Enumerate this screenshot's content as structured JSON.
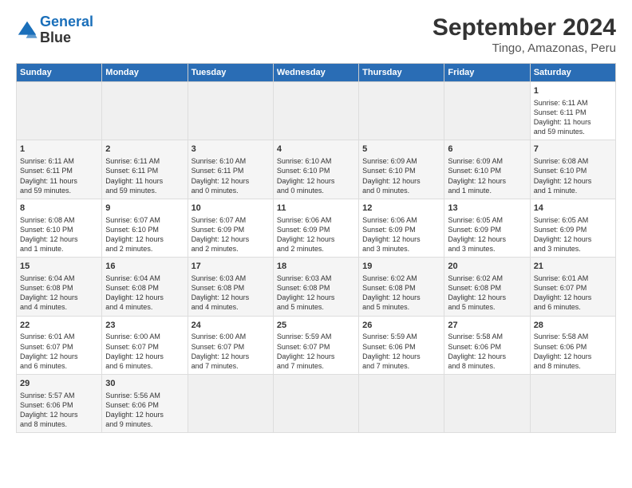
{
  "header": {
    "logo_line1": "General",
    "logo_line2": "Blue",
    "title": "September 2024",
    "subtitle": "Tingo, Amazonas, Peru"
  },
  "calendar": {
    "days_of_week": [
      "Sunday",
      "Monday",
      "Tuesday",
      "Wednesday",
      "Thursday",
      "Friday",
      "Saturday"
    ],
    "weeks": [
      [
        {
          "day": "",
          "content": ""
        },
        {
          "day": "",
          "content": ""
        },
        {
          "day": "",
          "content": ""
        },
        {
          "day": "",
          "content": ""
        },
        {
          "day": "",
          "content": ""
        },
        {
          "day": "",
          "content": ""
        },
        {
          "day": "1",
          "content": "Sunrise: 6:11 AM\nSunset: 6:11 PM\nDaylight: 11 hours\nand 59 minutes."
        }
      ],
      [
        {
          "day": "1",
          "content": "Sunrise: 6:11 AM\nSunset: 6:11 PM\nDaylight: 11 hours\nand 59 minutes."
        },
        {
          "day": "2",
          "content": "Sunrise: 6:11 AM\nSunset: 6:11 PM\nDaylight: 11 hours\nand 59 minutes."
        },
        {
          "day": "3",
          "content": "Sunrise: 6:10 AM\nSunset: 6:11 PM\nDaylight: 12 hours\nand 0 minutes."
        },
        {
          "day": "4",
          "content": "Sunrise: 6:10 AM\nSunset: 6:10 PM\nDaylight: 12 hours\nand 0 minutes."
        },
        {
          "day": "5",
          "content": "Sunrise: 6:09 AM\nSunset: 6:10 PM\nDaylight: 12 hours\nand 0 minutes."
        },
        {
          "day": "6",
          "content": "Sunrise: 6:09 AM\nSunset: 6:10 PM\nDaylight: 12 hours\nand 1 minute."
        },
        {
          "day": "7",
          "content": "Sunrise: 6:08 AM\nSunset: 6:10 PM\nDaylight: 12 hours\nand 1 minute."
        }
      ],
      [
        {
          "day": "8",
          "content": "Sunrise: 6:08 AM\nSunset: 6:10 PM\nDaylight: 12 hours\nand 1 minute."
        },
        {
          "day": "9",
          "content": "Sunrise: 6:07 AM\nSunset: 6:10 PM\nDaylight: 12 hours\nand 2 minutes."
        },
        {
          "day": "10",
          "content": "Sunrise: 6:07 AM\nSunset: 6:09 PM\nDaylight: 12 hours\nand 2 minutes."
        },
        {
          "day": "11",
          "content": "Sunrise: 6:06 AM\nSunset: 6:09 PM\nDaylight: 12 hours\nand 2 minutes."
        },
        {
          "day": "12",
          "content": "Sunrise: 6:06 AM\nSunset: 6:09 PM\nDaylight: 12 hours\nand 3 minutes."
        },
        {
          "day": "13",
          "content": "Sunrise: 6:05 AM\nSunset: 6:09 PM\nDaylight: 12 hours\nand 3 minutes."
        },
        {
          "day": "14",
          "content": "Sunrise: 6:05 AM\nSunset: 6:09 PM\nDaylight: 12 hours\nand 3 minutes."
        }
      ],
      [
        {
          "day": "15",
          "content": "Sunrise: 6:04 AM\nSunset: 6:08 PM\nDaylight: 12 hours\nand 4 minutes."
        },
        {
          "day": "16",
          "content": "Sunrise: 6:04 AM\nSunset: 6:08 PM\nDaylight: 12 hours\nand 4 minutes."
        },
        {
          "day": "17",
          "content": "Sunrise: 6:03 AM\nSunset: 6:08 PM\nDaylight: 12 hours\nand 4 minutes."
        },
        {
          "day": "18",
          "content": "Sunrise: 6:03 AM\nSunset: 6:08 PM\nDaylight: 12 hours\nand 5 minutes."
        },
        {
          "day": "19",
          "content": "Sunrise: 6:02 AM\nSunset: 6:08 PM\nDaylight: 12 hours\nand 5 minutes."
        },
        {
          "day": "20",
          "content": "Sunrise: 6:02 AM\nSunset: 6:08 PM\nDaylight: 12 hours\nand 5 minutes."
        },
        {
          "day": "21",
          "content": "Sunrise: 6:01 AM\nSunset: 6:07 PM\nDaylight: 12 hours\nand 6 minutes."
        }
      ],
      [
        {
          "day": "22",
          "content": "Sunrise: 6:01 AM\nSunset: 6:07 PM\nDaylight: 12 hours\nand 6 minutes."
        },
        {
          "day": "23",
          "content": "Sunrise: 6:00 AM\nSunset: 6:07 PM\nDaylight: 12 hours\nand 6 minutes."
        },
        {
          "day": "24",
          "content": "Sunrise: 6:00 AM\nSunset: 6:07 PM\nDaylight: 12 hours\nand 7 minutes."
        },
        {
          "day": "25",
          "content": "Sunrise: 5:59 AM\nSunset: 6:07 PM\nDaylight: 12 hours\nand 7 minutes."
        },
        {
          "day": "26",
          "content": "Sunrise: 5:59 AM\nSunset: 6:06 PM\nDaylight: 12 hours\nand 7 minutes."
        },
        {
          "day": "27",
          "content": "Sunrise: 5:58 AM\nSunset: 6:06 PM\nDaylight: 12 hours\nand 8 minutes."
        },
        {
          "day": "28",
          "content": "Sunrise: 5:58 AM\nSunset: 6:06 PM\nDaylight: 12 hours\nand 8 minutes."
        }
      ],
      [
        {
          "day": "29",
          "content": "Sunrise: 5:57 AM\nSunset: 6:06 PM\nDaylight: 12 hours\nand 8 minutes."
        },
        {
          "day": "30",
          "content": "Sunrise: 5:56 AM\nSunset: 6:06 PM\nDaylight: 12 hours\nand 9 minutes."
        },
        {
          "day": "",
          "content": ""
        },
        {
          "day": "",
          "content": ""
        },
        {
          "day": "",
          "content": ""
        },
        {
          "day": "",
          "content": ""
        },
        {
          "day": "",
          "content": ""
        }
      ]
    ]
  }
}
